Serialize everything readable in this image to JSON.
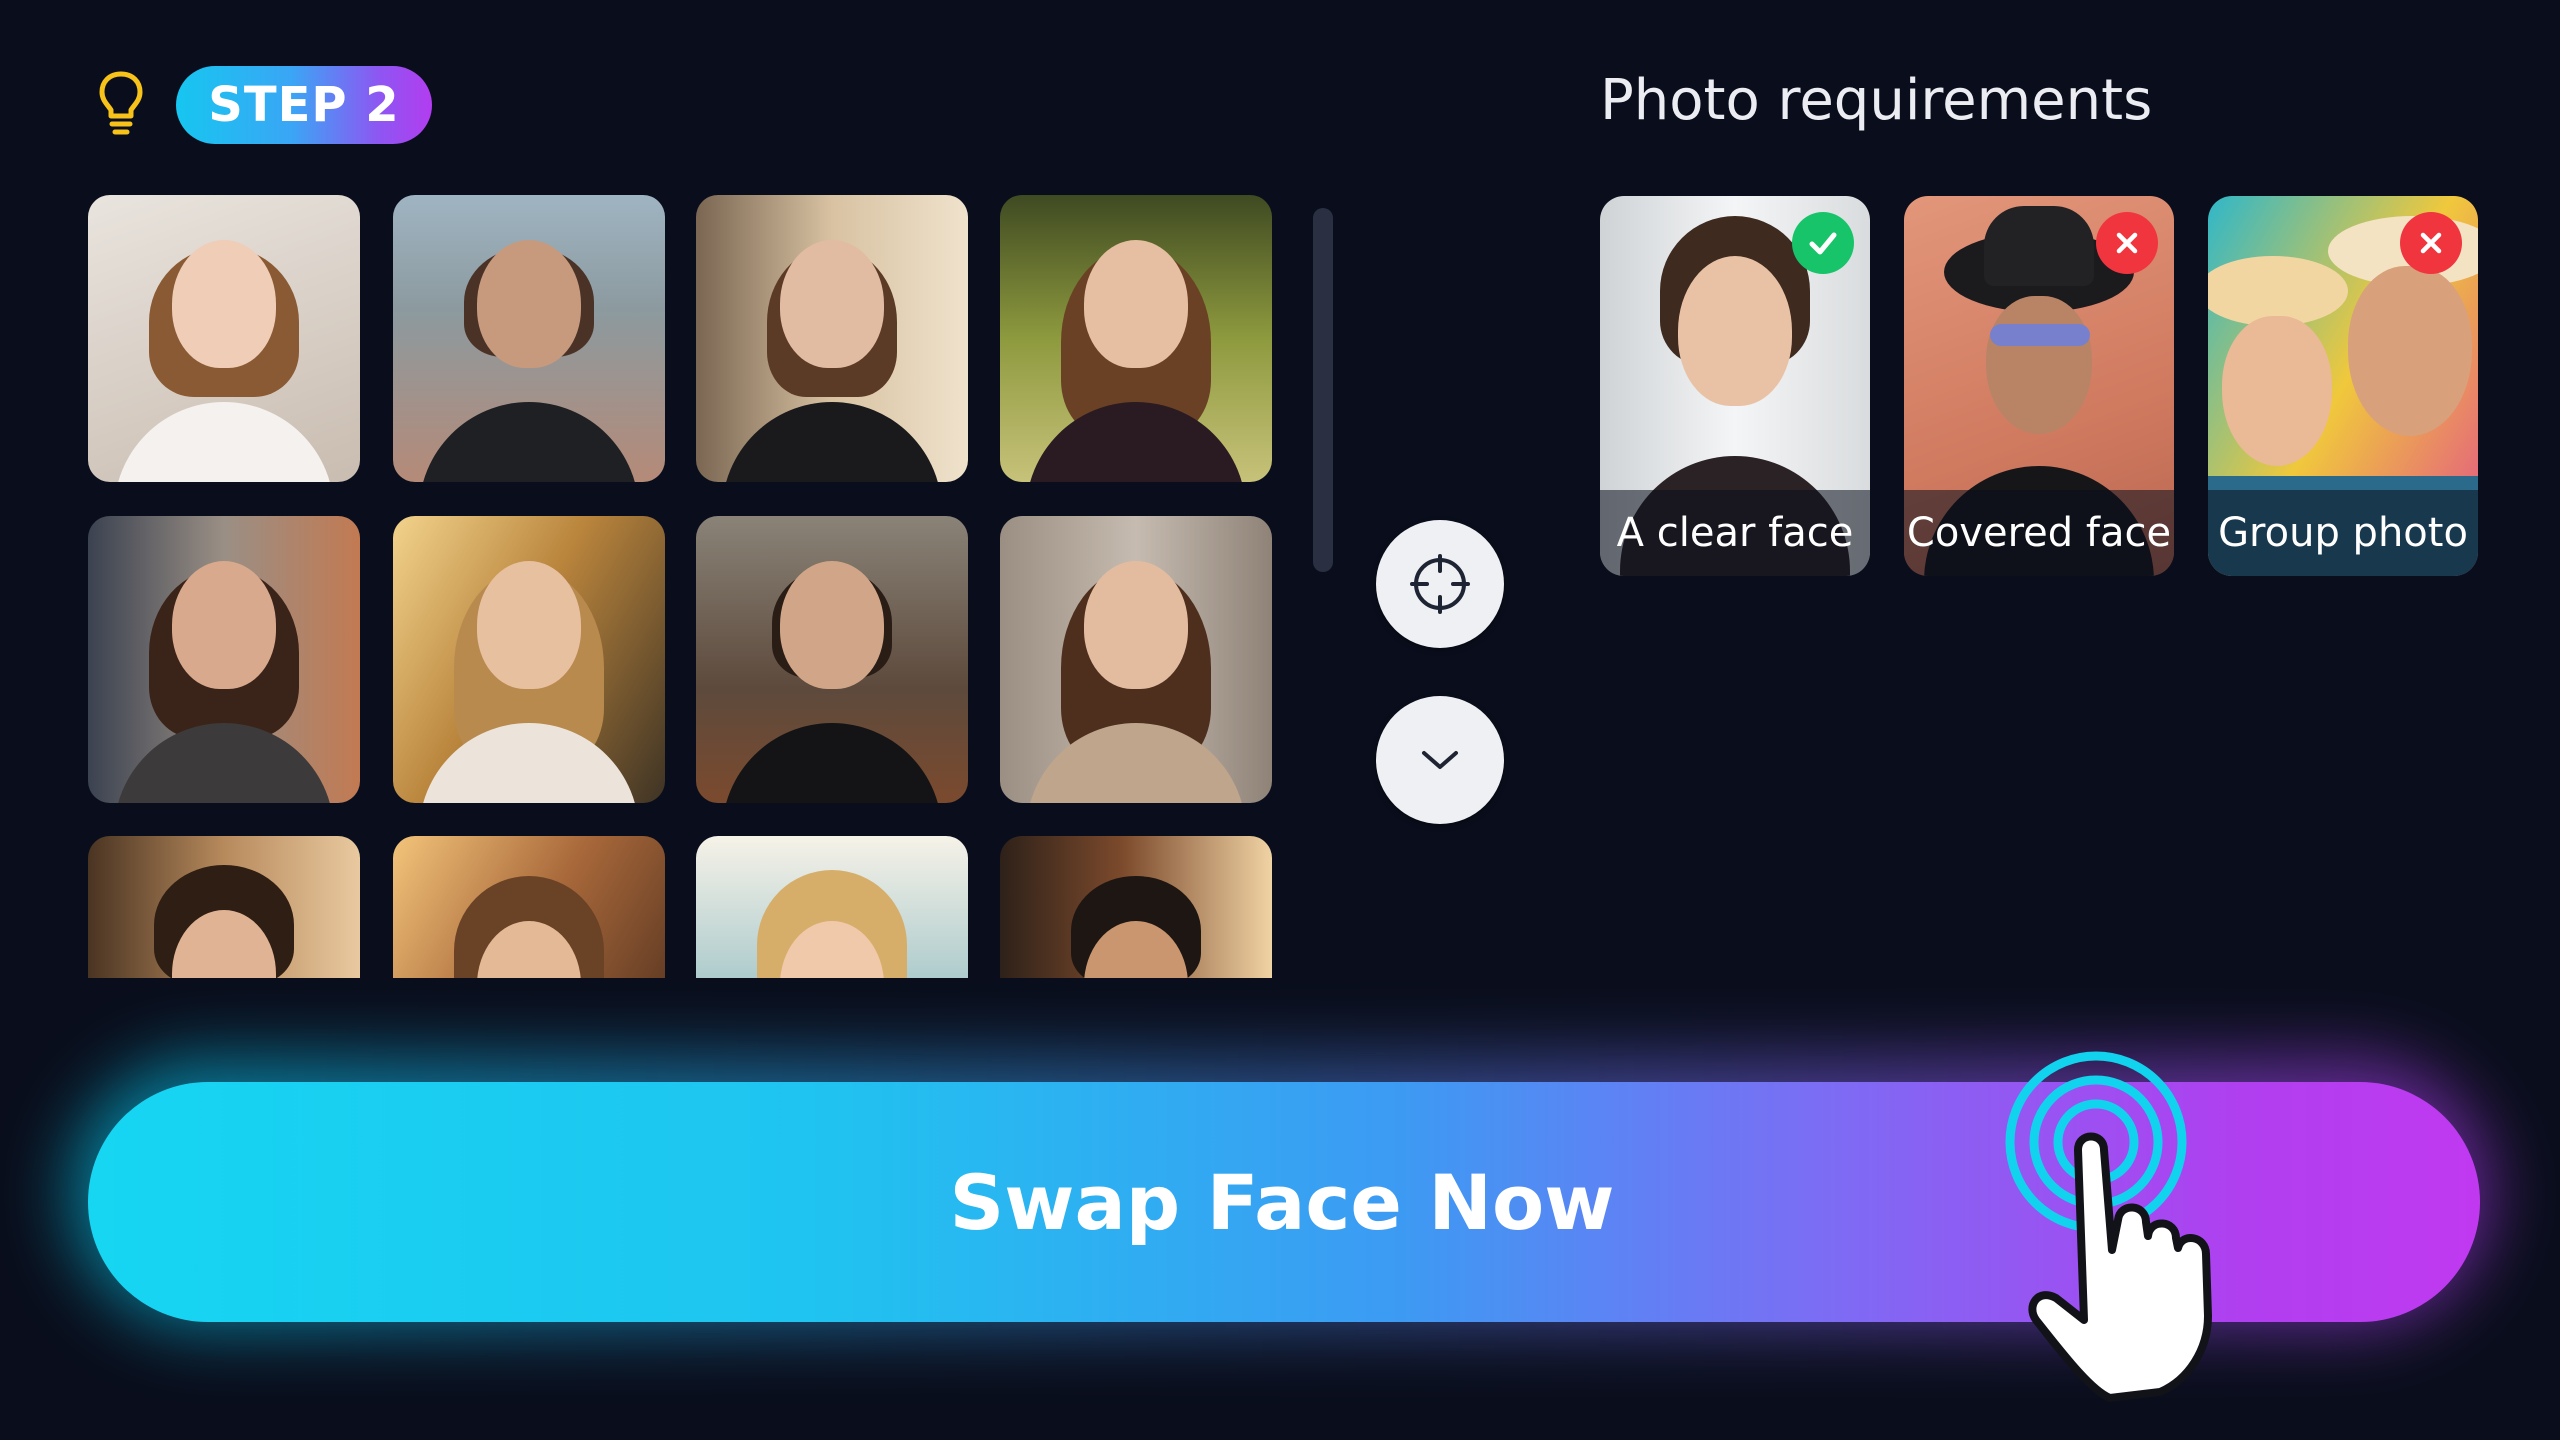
{
  "header": {
    "bulb_icon": "lightbulb-icon",
    "step_label": "STEP 2"
  },
  "gallery": {
    "tiles": [
      {
        "description_icon": "portrait-photo"
      },
      {
        "description_icon": "portrait-photo"
      },
      {
        "description_icon": "portrait-photo"
      },
      {
        "description_icon": "portrait-photo"
      },
      {
        "description_icon": "portrait-photo"
      },
      {
        "description_icon": "portrait-photo"
      },
      {
        "description_icon": "portrait-photo"
      },
      {
        "description_icon": "portrait-photo"
      },
      {
        "description_icon": "portrait-photo"
      },
      {
        "description_icon": "portrait-photo"
      },
      {
        "description_icon": "portrait-photo"
      },
      {
        "description_icon": "portrait-photo"
      }
    ],
    "buttons": {
      "target_icon": "crosshair-icon",
      "more_icon": "chevron-down-icon"
    }
  },
  "requirements": {
    "title": "Photo requirements",
    "cards": [
      {
        "label": "A clear face",
        "status": "ok",
        "status_icon": "check-icon",
        "status_color": "#17c469"
      },
      {
        "label": "Covered face",
        "status": "bad",
        "status_icon": "close-icon",
        "status_color": "#f0353f"
      },
      {
        "label": "Group photo",
        "status": "bad",
        "status_icon": "close-icon",
        "status_color": "#f0353f"
      }
    ]
  },
  "cta": {
    "label": "Swap Face Now",
    "pointer_icon": "hand-pointer-icon"
  },
  "colors": {
    "background": "#0a0e1c",
    "accent_cyan": "#16d6f2",
    "accent_purple": "#c039f0"
  }
}
